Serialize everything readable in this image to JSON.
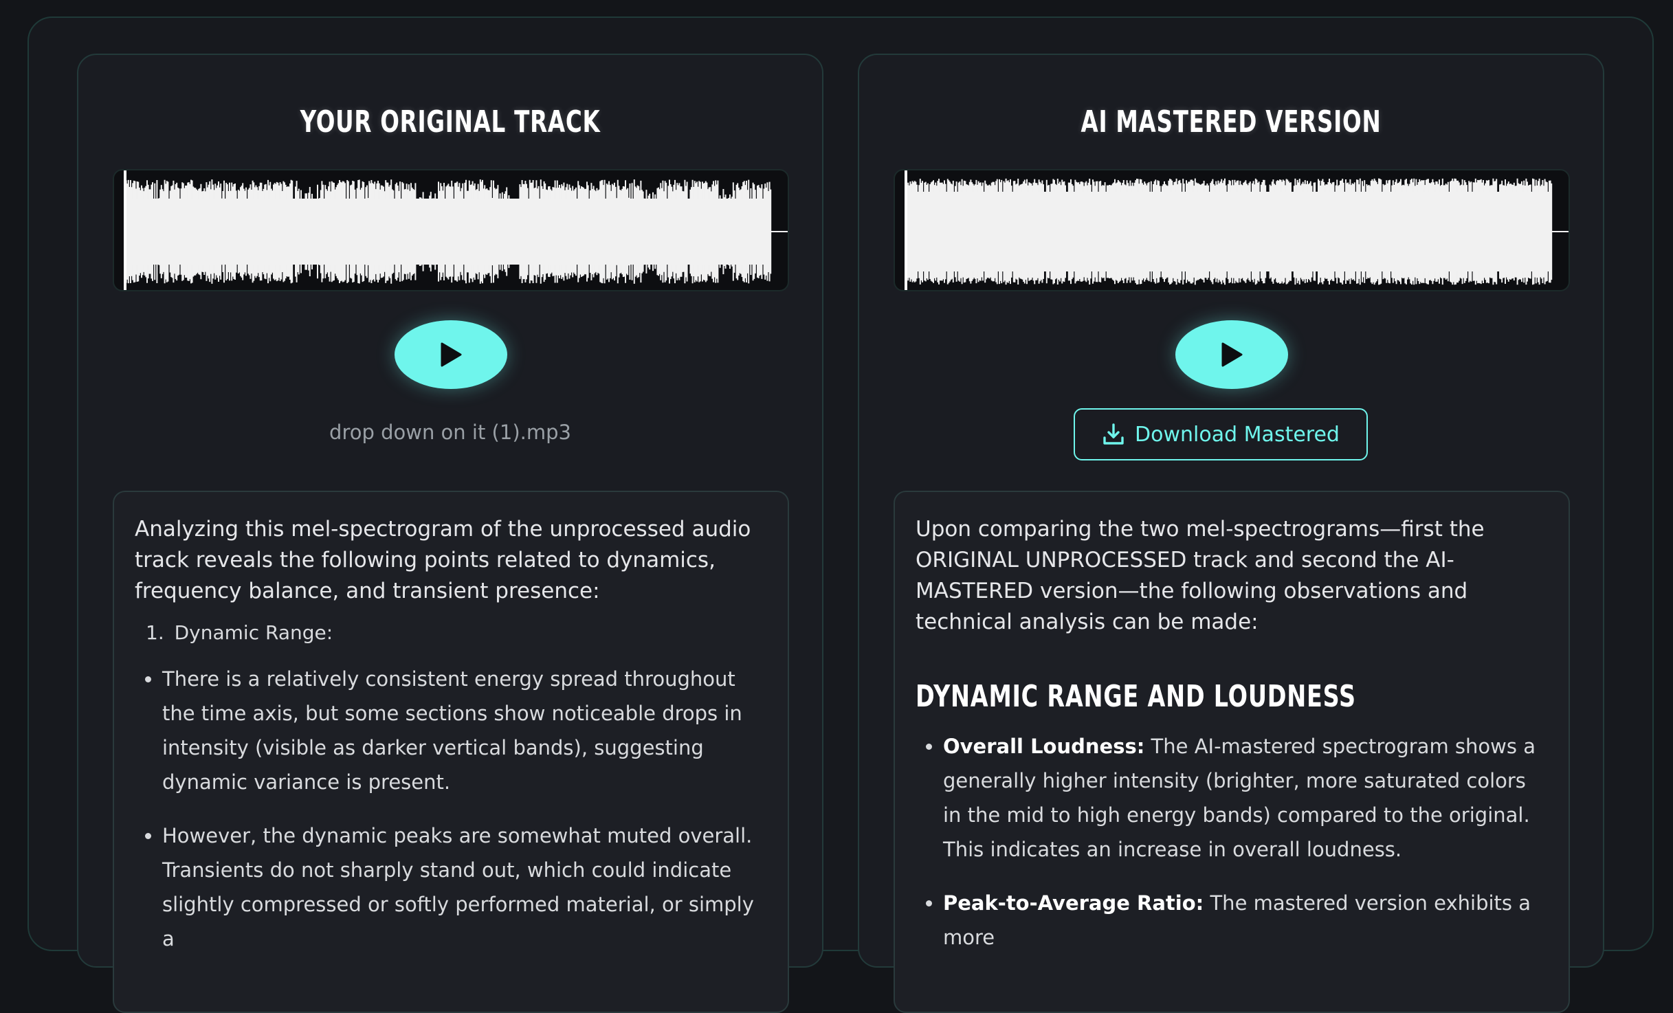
{
  "colors": {
    "accent": "#6ff5ec",
    "background": "#131519",
    "panel": "#1a1c22",
    "waveform": "#f1f1f1"
  },
  "original": {
    "title": "YOUR ORIGINAL TRACK",
    "filename": "drop down on it (1).mp3",
    "play_icon": "play-icon",
    "analysis": {
      "intro": "Analyzing this mel-spectrogram of the unprocessed audio track reveals the following points related to dynamics, frequency balance, and transient presence:",
      "numbered_item": "Dynamic Range:",
      "numbered_index": "1.",
      "bullets": [
        "There is a relatively consistent energy spread throughout the time axis, but some sections show noticeable drops in intensity (visible as darker vertical bands), suggesting dynamic variance is present.",
        "However, the dynamic peaks are somewhat muted overall. Transients do not sharply stand out, which could indicate slightly compressed or softly performed material, or simply a"
      ]
    }
  },
  "mastered": {
    "title": "AI MASTERED VERSION",
    "download_label": "Download Mastered",
    "download_icon": "download-icon",
    "play_icon": "play-icon",
    "analysis": {
      "intro": "Upon comparing the two mel-spectrograms—first the ORIGINAL UNPROCESSED track and second the AI-MASTERED version—the following observations and technical analysis can be made:",
      "heading": "DYNAMIC RANGE AND LOUDNESS",
      "bullets": [
        {
          "label": "Overall Loudness:",
          "text": " The AI-mastered spectrogram shows a generally higher intensity (brighter, more saturated colors in the mid to high energy bands) compared to the original. This indicates an increase in overall loudness."
        },
        {
          "label": "Peak-to-Average Ratio:",
          "text": " The mastered version exhibits a more"
        }
      ]
    }
  }
}
